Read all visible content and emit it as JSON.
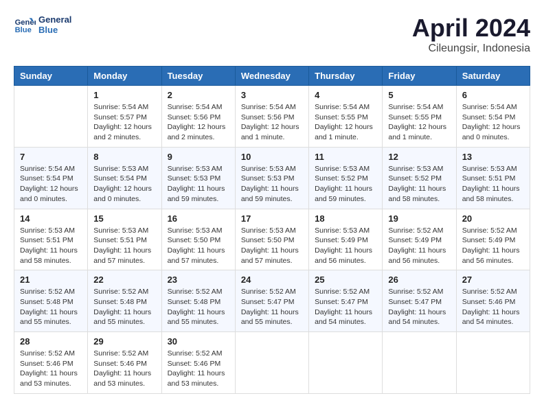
{
  "header": {
    "logo_line1": "General",
    "logo_line2": "Blue",
    "month_title": "April 2024",
    "subtitle": "Cileungsir, Indonesia"
  },
  "days_of_week": [
    "Sunday",
    "Monday",
    "Tuesday",
    "Wednesday",
    "Thursday",
    "Friday",
    "Saturday"
  ],
  "weeks": [
    [
      {
        "day": "",
        "info": ""
      },
      {
        "day": "1",
        "info": "Sunrise: 5:54 AM\nSunset: 5:57 PM\nDaylight: 12 hours\nand 2 minutes."
      },
      {
        "day": "2",
        "info": "Sunrise: 5:54 AM\nSunset: 5:56 PM\nDaylight: 12 hours\nand 2 minutes."
      },
      {
        "day": "3",
        "info": "Sunrise: 5:54 AM\nSunset: 5:56 PM\nDaylight: 12 hours\nand 1 minute."
      },
      {
        "day": "4",
        "info": "Sunrise: 5:54 AM\nSunset: 5:55 PM\nDaylight: 12 hours\nand 1 minute."
      },
      {
        "day": "5",
        "info": "Sunrise: 5:54 AM\nSunset: 5:55 PM\nDaylight: 12 hours\nand 1 minute."
      },
      {
        "day": "6",
        "info": "Sunrise: 5:54 AM\nSunset: 5:54 PM\nDaylight: 12 hours\nand 0 minutes."
      }
    ],
    [
      {
        "day": "7",
        "info": "Sunrise: 5:54 AM\nSunset: 5:54 PM\nDaylight: 12 hours\nand 0 minutes."
      },
      {
        "day": "8",
        "info": "Sunrise: 5:53 AM\nSunset: 5:54 PM\nDaylight: 12 hours\nand 0 minutes."
      },
      {
        "day": "9",
        "info": "Sunrise: 5:53 AM\nSunset: 5:53 PM\nDaylight: 11 hours\nand 59 minutes."
      },
      {
        "day": "10",
        "info": "Sunrise: 5:53 AM\nSunset: 5:53 PM\nDaylight: 11 hours\nand 59 minutes."
      },
      {
        "day": "11",
        "info": "Sunrise: 5:53 AM\nSunset: 5:52 PM\nDaylight: 11 hours\nand 59 minutes."
      },
      {
        "day": "12",
        "info": "Sunrise: 5:53 AM\nSunset: 5:52 PM\nDaylight: 11 hours\nand 58 minutes."
      },
      {
        "day": "13",
        "info": "Sunrise: 5:53 AM\nSunset: 5:51 PM\nDaylight: 11 hours\nand 58 minutes."
      }
    ],
    [
      {
        "day": "14",
        "info": "Sunrise: 5:53 AM\nSunset: 5:51 PM\nDaylight: 11 hours\nand 58 minutes."
      },
      {
        "day": "15",
        "info": "Sunrise: 5:53 AM\nSunset: 5:51 PM\nDaylight: 11 hours\nand 57 minutes."
      },
      {
        "day": "16",
        "info": "Sunrise: 5:53 AM\nSunset: 5:50 PM\nDaylight: 11 hours\nand 57 minutes."
      },
      {
        "day": "17",
        "info": "Sunrise: 5:53 AM\nSunset: 5:50 PM\nDaylight: 11 hours\nand 57 minutes."
      },
      {
        "day": "18",
        "info": "Sunrise: 5:53 AM\nSunset: 5:49 PM\nDaylight: 11 hours\nand 56 minutes."
      },
      {
        "day": "19",
        "info": "Sunrise: 5:52 AM\nSunset: 5:49 PM\nDaylight: 11 hours\nand 56 minutes."
      },
      {
        "day": "20",
        "info": "Sunrise: 5:52 AM\nSunset: 5:49 PM\nDaylight: 11 hours\nand 56 minutes."
      }
    ],
    [
      {
        "day": "21",
        "info": "Sunrise: 5:52 AM\nSunset: 5:48 PM\nDaylight: 11 hours\nand 55 minutes."
      },
      {
        "day": "22",
        "info": "Sunrise: 5:52 AM\nSunset: 5:48 PM\nDaylight: 11 hours\nand 55 minutes."
      },
      {
        "day": "23",
        "info": "Sunrise: 5:52 AM\nSunset: 5:48 PM\nDaylight: 11 hours\nand 55 minutes."
      },
      {
        "day": "24",
        "info": "Sunrise: 5:52 AM\nSunset: 5:47 PM\nDaylight: 11 hours\nand 55 minutes."
      },
      {
        "day": "25",
        "info": "Sunrise: 5:52 AM\nSunset: 5:47 PM\nDaylight: 11 hours\nand 54 minutes."
      },
      {
        "day": "26",
        "info": "Sunrise: 5:52 AM\nSunset: 5:47 PM\nDaylight: 11 hours\nand 54 minutes."
      },
      {
        "day": "27",
        "info": "Sunrise: 5:52 AM\nSunset: 5:46 PM\nDaylight: 11 hours\nand 54 minutes."
      }
    ],
    [
      {
        "day": "28",
        "info": "Sunrise: 5:52 AM\nSunset: 5:46 PM\nDaylight: 11 hours\nand 53 minutes."
      },
      {
        "day": "29",
        "info": "Sunrise: 5:52 AM\nSunset: 5:46 PM\nDaylight: 11 hours\nand 53 minutes."
      },
      {
        "day": "30",
        "info": "Sunrise: 5:52 AM\nSunset: 5:46 PM\nDaylight: 11 hours\nand 53 minutes."
      },
      {
        "day": "",
        "info": ""
      },
      {
        "day": "",
        "info": ""
      },
      {
        "day": "",
        "info": ""
      },
      {
        "day": "",
        "info": ""
      }
    ]
  ]
}
